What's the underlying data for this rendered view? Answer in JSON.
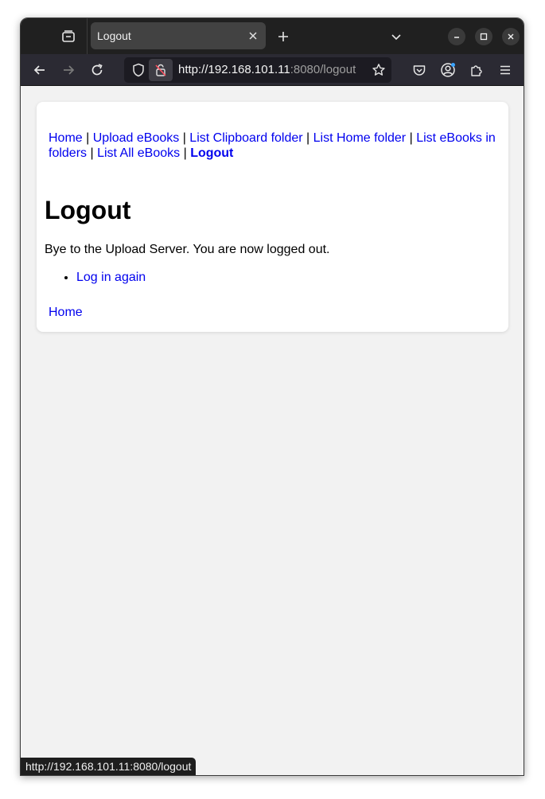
{
  "browser": {
    "tab_title": "Logout",
    "url_host": "http://192.168.101.11",
    "url_rest": ":8080/logout"
  },
  "nav": {
    "home": "Home",
    "upload": "Upload eBooks",
    "clipboard": "List Clipboard folder",
    "homefolder": "List Home folder",
    "ebooks_in_folders": "List eBooks in folders",
    "all_ebooks": "List All eBooks",
    "logout": "Logout",
    "separator": " | "
  },
  "page": {
    "title": "Logout",
    "message": "Bye to the Upload Server. You are now logged out.",
    "login_again": "Log in again",
    "home_link": "Home"
  },
  "status": {
    "hover_url": "http://192.168.101.11:8080/logout"
  }
}
